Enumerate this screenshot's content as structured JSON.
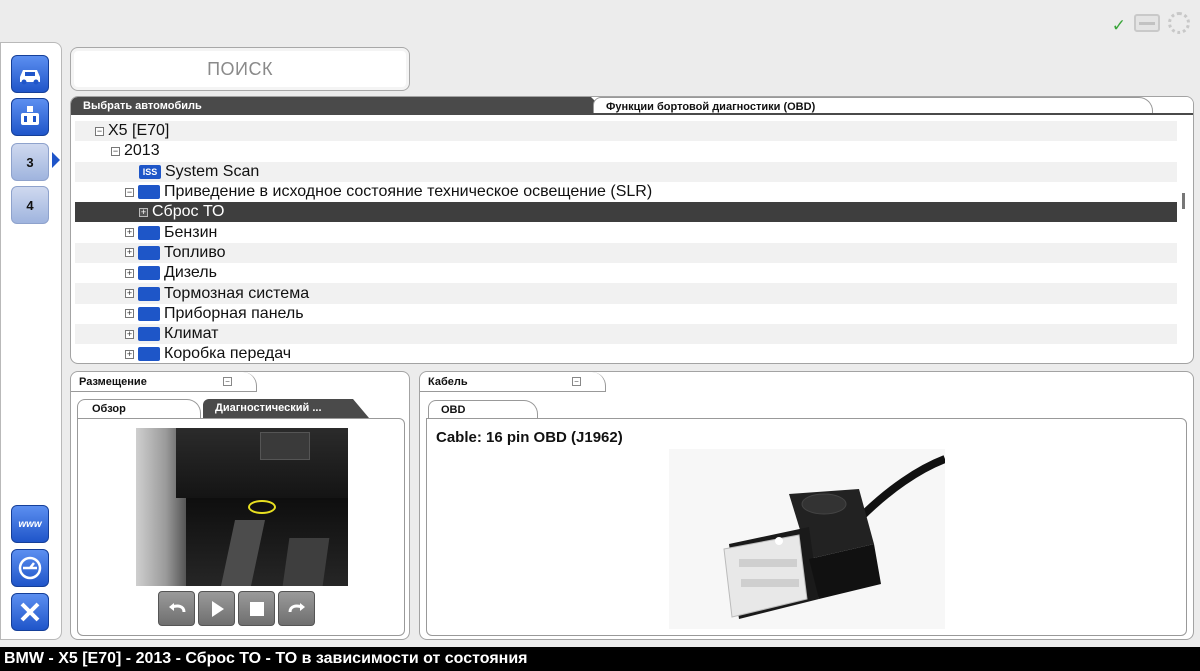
{
  "search": {
    "placeholder": "ПОИСК"
  },
  "sidebar": {
    "items": [
      {
        "icon": "car-icon"
      },
      {
        "icon": "vehicle-diagnostics-icon"
      },
      {
        "icon": "step-3-icon",
        "label": "3"
      },
      {
        "icon": "step-4-icon",
        "label": "4"
      }
    ],
    "bottom": [
      {
        "icon": "www-icon",
        "label": "www"
      },
      {
        "icon": "settings-icon"
      },
      {
        "icon": "close-icon"
      }
    ]
  },
  "top_tabs": {
    "active": "Выбрать автомобиль",
    "inactive": "Функции бортовой диагностики (OBD)"
  },
  "tree": [
    {
      "text": "X5 [E70]",
      "expander": "⊟"
    },
    {
      "text": "2013",
      "expander": "⊟"
    },
    {
      "text": "System Scan",
      "icon_label": "ISS",
      "icon": "system-scan-icon"
    },
    {
      "text": "Приведение в исходное состояние техническое освещение (SLR)",
      "expander": "⊟",
      "icon": "wrench-icon"
    },
    {
      "text": "Сброс ТО",
      "expander": "⊞",
      "selected": true
    },
    {
      "text": "Бензин",
      "expander": "⊞",
      "icon": "petrol-icon"
    },
    {
      "text": "Топливо",
      "expander": "⊞",
      "icon": "fuel-icon"
    },
    {
      "text": "Дизель",
      "expander": "⊞",
      "icon": "diesel-glow-icon"
    },
    {
      "text": "Тормозная система",
      "expander": "⊞",
      "icon": "abs-icon"
    },
    {
      "text": "Приборная панель",
      "expander": "⊞",
      "icon": "dashboard-icon"
    },
    {
      "text": "Климат",
      "expander": "⊞",
      "icon": "climate-icon"
    },
    {
      "text": "Коробка передач",
      "expander": "⊞",
      "icon": "gearbox-icon"
    }
  ],
  "placement_panel": {
    "title": "Размещение",
    "tabs": [
      "Обзор",
      "Диагностический ..."
    ]
  },
  "cable_panel": {
    "title": "Кабель",
    "tab": "OBD",
    "cable_text": "Cable: 16 pin OBD (J1962)"
  },
  "status_bar": "BMW - X5 [E70] - 2013 - Сброс ТО - ТО в зависимости от состояния",
  "colors": {
    "accent_blue": "#1f55c9",
    "dark_tab": "#4a4a4a",
    "selected_row": "#3e3e3e",
    "status_ok": "#3aa53a"
  }
}
